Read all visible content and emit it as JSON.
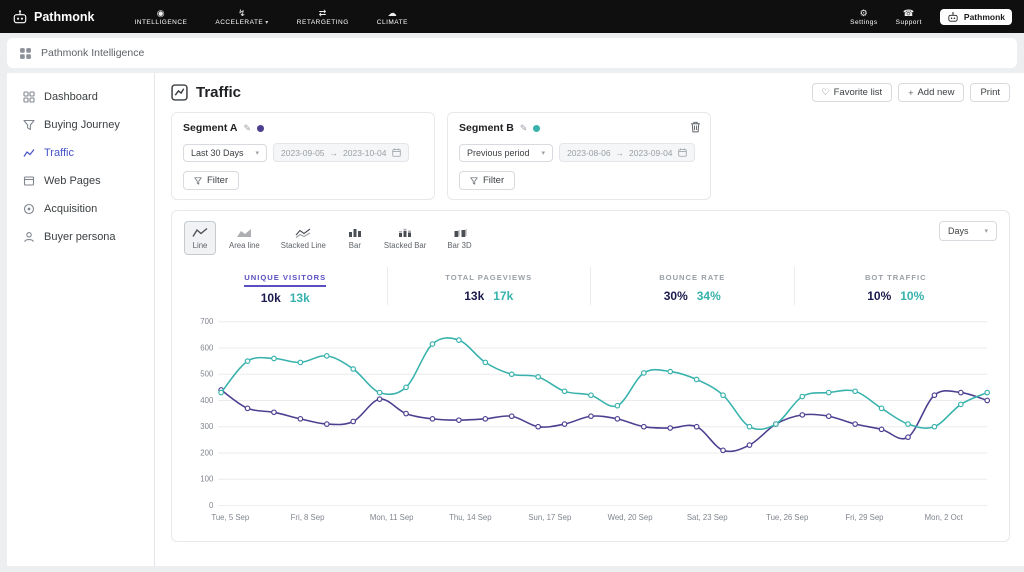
{
  "topbar": {
    "brand": "Pathmonk",
    "nav": [
      {
        "label": "INTELLIGENCE"
      },
      {
        "label": "ACCELERATE",
        "has_dropdown": true
      },
      {
        "label": "RETARGETING"
      },
      {
        "label": "CLIMATE"
      }
    ],
    "settings": "Settings",
    "support": "Support",
    "badge": "Pathmonk"
  },
  "subbar": {
    "title": "Pathmonk Intelligence"
  },
  "sidebar": {
    "items": [
      {
        "label": "Dashboard"
      },
      {
        "label": "Buying Journey"
      },
      {
        "label": "Traffic",
        "active": true
      },
      {
        "label": "Web Pages"
      },
      {
        "label": "Acquisition"
      },
      {
        "label": "Buyer persona"
      }
    ]
  },
  "page": {
    "title": "Traffic",
    "actions": {
      "favorite": "Favorite list",
      "add": "Add new",
      "print": "Print"
    }
  },
  "segments": [
    {
      "name": "Segment A",
      "color": "#4d3f90",
      "range_label": "Last 30 Days",
      "date_from": "2023-09-05",
      "date_to": "2023-10-04",
      "filter_label": "Filter"
    },
    {
      "name": "Segment B",
      "color": "#38b2ac",
      "range_label": "Previous period",
      "date_from": "2023-08-06",
      "date_to": "2023-09-04",
      "filter_label": "Filter",
      "deletable": true
    }
  ],
  "chart_controls": {
    "types": [
      {
        "label": "Line",
        "active": true
      },
      {
        "label": "Area line"
      },
      {
        "label": "Stacked Line"
      },
      {
        "label": "Bar"
      },
      {
        "label": "Stacked Bar"
      },
      {
        "label": "Bar 3D"
      }
    ],
    "interval": "Days"
  },
  "stats": [
    {
      "label": "UNIQUE VISITORS",
      "a": "10k",
      "b": "13k",
      "active": true
    },
    {
      "label": "TOTAL PAGEVIEWS",
      "a": "13k",
      "b": "17k"
    },
    {
      "label": "BOUNCE RATE",
      "a": "30%",
      "b": "34%"
    },
    {
      "label": "BOT TRAFFIC",
      "a": "10%",
      "b": "10%"
    }
  ],
  "chart_data": {
    "type": "line",
    "title": "Traffic — Unique Visitors per day, Segment A vs Segment B",
    "x_tick_labels": [
      "Tue, 5 Sep",
      "Fri, 8 Sep",
      "Mon, 11 Sep",
      "Thu, 14 Sep",
      "Sun, 17 Sep",
      "Wed, 20 Sep",
      "Sat, 23 Sep",
      "Tue, 26 Sep",
      "Fri, 29 Sep",
      "Mon, 2 Oct"
    ],
    "tick_every": 3,
    "ylim": [
      0,
      700
    ],
    "y_ticks": [
      0,
      100,
      200,
      300,
      400,
      500,
      600,
      700
    ],
    "grid": true,
    "legend_position": "none",
    "series": [
      {
        "name": "Segment A",
        "color": "#4d3f90",
        "values": [
          440,
          370,
          355,
          330,
          310,
          320,
          405,
          350,
          330,
          325,
          330,
          340,
          300,
          310,
          340,
          330,
          300,
          295,
          300,
          210,
          230,
          310,
          345,
          340,
          310,
          290,
          260,
          420,
          430,
          400
        ]
      },
      {
        "name": "Segment B",
        "color": "#38b2ac",
        "values": [
          430,
          550,
          560,
          545,
          570,
          520,
          430,
          450,
          615,
          630,
          545,
          500,
          490,
          435,
          420,
          380,
          505,
          510,
          480,
          420,
          300,
          310,
          415,
          430,
          435,
          370,
          310,
          300,
          385,
          430
        ]
      }
    ]
  },
  "icons": {
    "intelligence": "◉",
    "accelerate": "↯",
    "retargeting": "⇄",
    "climate": "☁",
    "settings": "⚙",
    "support": "☎",
    "chevron": "▾",
    "heart": "♡",
    "plus": "+",
    "pencil": "✎",
    "arrow": "→"
  },
  "colors": {
    "segment_a": "#4d3f90",
    "segment_b": "#38b2ac",
    "accent": "#4353c8",
    "value_dark": "#1b1a4e",
    "stat_label_active": "#5a4fc0"
  }
}
